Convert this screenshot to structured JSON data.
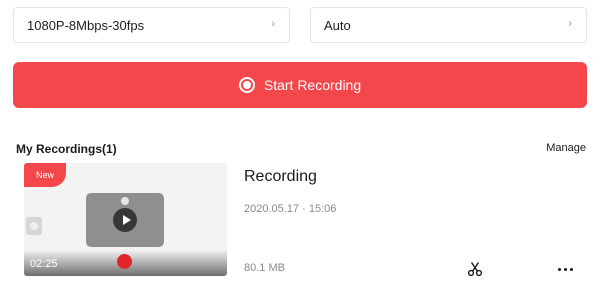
{
  "settings": {
    "quality": {
      "value": "1080P-8Mbps-30fps",
      "chevron": "›"
    },
    "mode": {
      "value": "Auto",
      "chevron": "›"
    }
  },
  "record_button": {
    "label": "Start Recording",
    "icon": "record-icon"
  },
  "recordings": {
    "title": "My Recordings(1)",
    "manage_label": "Manage",
    "items": [
      {
        "badge": "New",
        "duration": "02:25",
        "title": "Recording",
        "date": "2020.05.17 · 15:06",
        "size": "80.1 MB",
        "actions": [
          "scissors-icon",
          "more-icon"
        ]
      }
    ]
  },
  "colors": {
    "accent": "#f4474b",
    "muted_text": "#8a8a8a"
  }
}
